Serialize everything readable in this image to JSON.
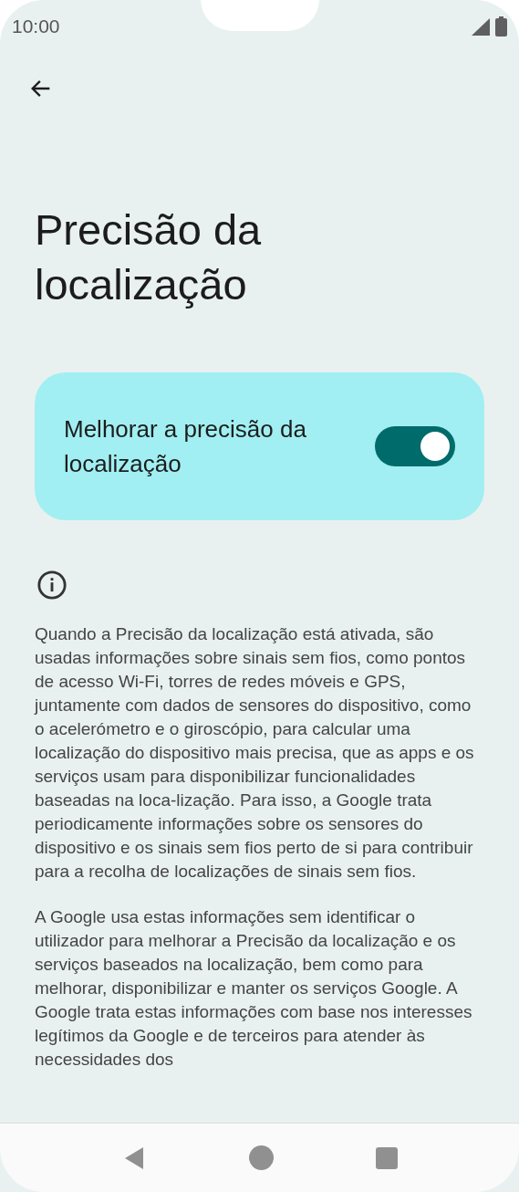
{
  "status_bar": {
    "time": "10:00"
  },
  "title": "Precisão da localização",
  "toggle_card": {
    "label": "Melhorar a precisão da localização",
    "on": true
  },
  "paragraphs": [
    "Quando a Precisão da localização está ativada, são usadas informações sobre sinais sem fios, como pontos de acesso Wi-Fi, torres de redes móveis e GPS, juntamente com dados de sensores do dispositivo, como o acelerómetro e o giroscópio, para calcular uma localização do dispositivo mais precisa, que as apps e os serviços usam para disponibilizar funcionalidades baseadas na loca-lização. Para isso, a Google trata periodicamente informações sobre os sensores do dispositivo e os sinais sem fios perto de si para contribuir para a recolha de localizações de sinais sem fios.",
    "A Google usa estas informações sem identificar o utilizador para melhorar a Precisão da localização e os serviços baseados na localização, bem como para melhorar, disponibilizar e manter os serviços Google. A Google trata estas informações com base nos interesses legítimos da Google e de terceiros para atender às necessidades dos"
  ]
}
